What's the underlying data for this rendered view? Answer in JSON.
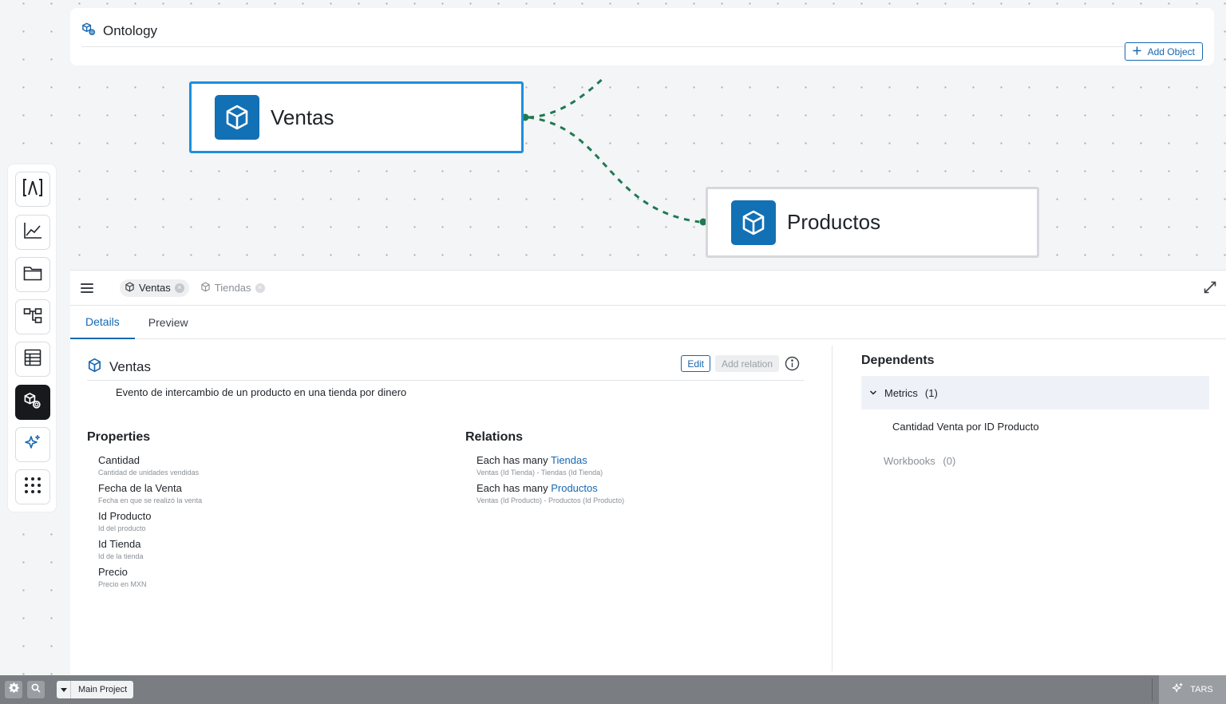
{
  "header": {
    "title": "Ontology",
    "add_object_label": "Add Object"
  },
  "canvas": {
    "nodes": [
      {
        "label": "Ventas",
        "selected": true
      },
      {
        "label": "Productos",
        "selected": false
      }
    ]
  },
  "rail": {
    "items": [
      {
        "icon": "lambda-icon",
        "active": false
      },
      {
        "icon": "line-chart-icon",
        "active": false
      },
      {
        "icon": "folder-icon",
        "active": false
      },
      {
        "icon": "hierarchy-icon",
        "active": false
      },
      {
        "icon": "table-icon",
        "active": false
      },
      {
        "icon": "cube-stack-icon",
        "active": true
      },
      {
        "icon": "sparkle-icon",
        "active": false
      },
      {
        "icon": "grid-dots-icon",
        "active": false
      }
    ]
  },
  "panel": {
    "chips": [
      {
        "label": "Ventas",
        "active": true
      },
      {
        "label": "Tiendas",
        "active": false
      }
    ],
    "tabs": [
      {
        "label": "Details",
        "active": true
      },
      {
        "label": "Preview",
        "active": false
      }
    ],
    "object": {
      "title": "Ventas",
      "edit_label": "Edit",
      "add_relation_label": "Add relation",
      "description": "Evento de intercambio de un producto en una tienda por dinero"
    },
    "properties": {
      "title": "Properties",
      "items": [
        {
          "name": "Cantidad",
          "description": "Cantidad de unidades vendidas"
        },
        {
          "name": "Fecha de la Venta",
          "description": "Fecha en que se realizó la venta"
        },
        {
          "name": "Id Producto",
          "description": "Id del producto"
        },
        {
          "name": "Id Tienda",
          "description": "Id de la tienda"
        },
        {
          "name": "Precio",
          "description": "Precio en MXN"
        }
      ]
    },
    "relations": {
      "title": "Relations",
      "items": [
        {
          "prefix": "Each has many ",
          "target": "Tiendas",
          "description": "Ventas (Id Tienda) - Tiendas (Id Tienda)"
        },
        {
          "prefix": "Each has many ",
          "target": "Productos",
          "description": "Ventas (Id Producto) - Productos (Id Producto)"
        }
      ]
    },
    "dependents": {
      "title": "Dependents",
      "metrics_label": "Metrics",
      "metrics_count": "(1)",
      "metrics_items": [
        "Cantidad Venta por ID Producto"
      ],
      "workbooks_label": "Workbooks",
      "workbooks_count": "(0)"
    }
  },
  "statusbar": {
    "project_label": "Main Project",
    "assistant_label": "TARS"
  },
  "colors": {
    "accent": "#1767b0",
    "node_icon_bg": "#1270b5",
    "selected_border": "#1d8fe0",
    "edge": "#1e7a52"
  }
}
